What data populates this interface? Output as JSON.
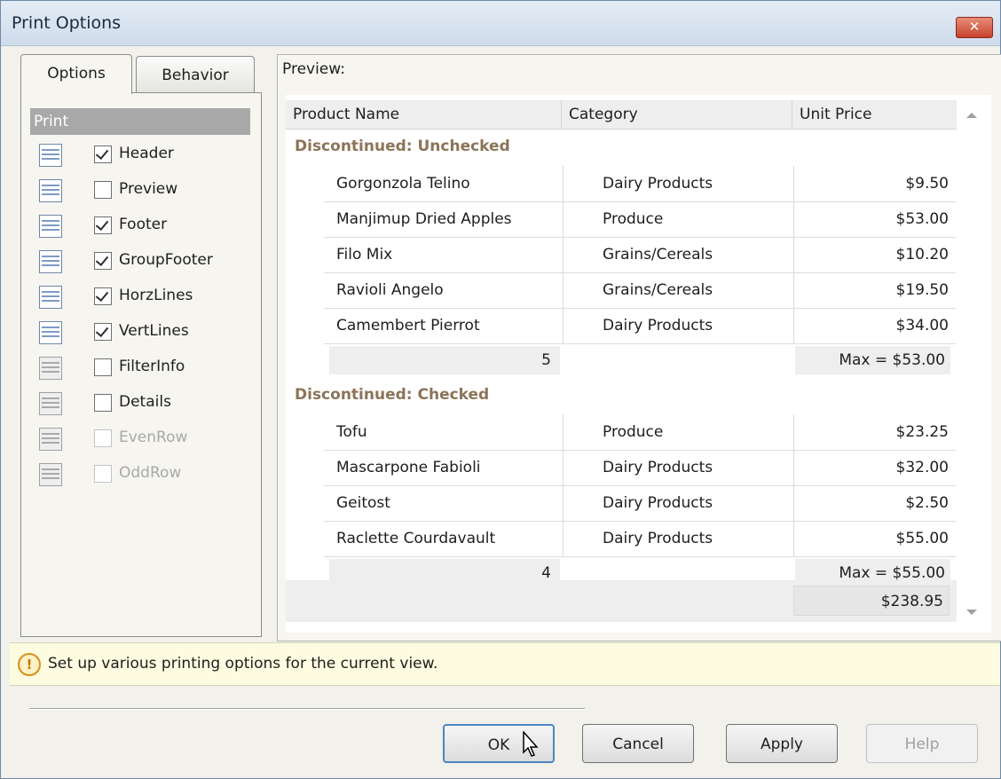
{
  "window": {
    "title": "Print Options"
  },
  "tabs": [
    {
      "label": "Options"
    },
    {
      "label": "Behavior"
    }
  ],
  "print_group": {
    "title": "Print"
  },
  "options": [
    {
      "label": "Header",
      "checked": true,
      "enabled": true,
      "icon": "header-grid-icon"
    },
    {
      "label": "Preview",
      "checked": false,
      "enabled": true,
      "icon": "preview-grid-icon"
    },
    {
      "label": "Footer",
      "checked": true,
      "enabled": true,
      "icon": "footer-grid-icon"
    },
    {
      "label": "GroupFooter",
      "checked": true,
      "enabled": true,
      "icon": "group-footer-grid-icon"
    },
    {
      "label": "HorzLines",
      "checked": true,
      "enabled": true,
      "icon": "horizontal-lines-icon"
    },
    {
      "label": "VertLines",
      "checked": true,
      "enabled": true,
      "icon": "vertical-lines-icon"
    },
    {
      "label": "FilterInfo",
      "checked": false,
      "enabled": true,
      "icon": "filter-info-icon"
    },
    {
      "label": "Details",
      "checked": false,
      "enabled": true,
      "icon": "details-icon"
    },
    {
      "label": "EvenRow",
      "checked": false,
      "enabled": false,
      "icon": "even-row-icon"
    },
    {
      "label": "OddRow",
      "checked": false,
      "enabled": false,
      "icon": "odd-row-icon"
    }
  ],
  "preview": {
    "label": "Preview:",
    "columns": [
      "Product Name",
      "Category",
      "Unit Price"
    ],
    "groups": [
      {
        "title": "Discontinued: Unchecked",
        "rows": [
          [
            "Gorgonzola Telino",
            "Dairy Products",
            "$9.50"
          ],
          [
            "Manjimup Dried Apples",
            "Produce",
            "$53.00"
          ],
          [
            "Filo Mix",
            "Grains/Cereals",
            "$10.20"
          ],
          [
            "Ravioli Angelo",
            "Grains/Cereals",
            "$19.50"
          ],
          [
            "Camembert Pierrot",
            "Dairy Products",
            "$34.00"
          ]
        ],
        "count": "5",
        "max": "Max = $53.00"
      },
      {
        "title": "Discontinued: Checked",
        "rows": [
          [
            "Tofu",
            "Produce",
            "$23.25"
          ],
          [
            "Mascarpone Fabioli",
            "Dairy Products",
            "$32.00"
          ],
          [
            "Geitost",
            "Dairy Products",
            "$2.50"
          ],
          [
            "Raclette Courdavault",
            "Dairy Products",
            "$55.00"
          ]
        ],
        "count": "4",
        "max": "Max = $55.00"
      }
    ],
    "total": "$238.95"
  },
  "hint": {
    "text": "Set up various printing options for the current view."
  },
  "buttons": {
    "ok": "OK",
    "cancel": "Cancel",
    "apply": "Apply",
    "help": "Help"
  }
}
